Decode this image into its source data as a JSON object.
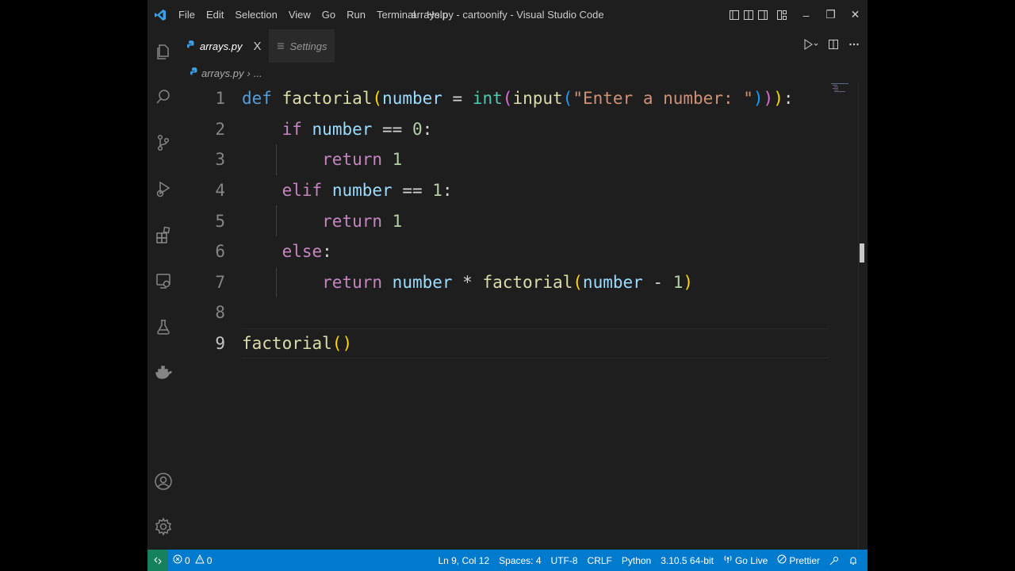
{
  "window": {
    "title": "arrays.py - cartoonify - Visual Studio Code",
    "minimize": "–",
    "maximize": "❐",
    "close": "✕"
  },
  "menu": [
    "File",
    "Edit",
    "Selection",
    "View",
    "Go",
    "Run",
    "Terminal",
    "Help"
  ],
  "activity_bar": [
    "explorer-icon",
    "search-icon",
    "source-control-icon",
    "run-debug-icon",
    "extensions-icon",
    "remote-explorer-icon",
    "testing-icon",
    "docker-icon",
    "accounts-icon",
    "settings-gear-icon"
  ],
  "tabs": [
    {
      "label": "arrays.py",
      "close": "X",
      "icon": "python-icon"
    },
    {
      "label": "Settings",
      "icon": "settings-list-icon"
    }
  ],
  "breadcrumb": {
    "file": "arrays.py",
    "separator": "›",
    "more": "..."
  },
  "editor": {
    "current_line": 9,
    "lines": [
      {
        "num": "1",
        "tokens": [
          [
            "kw",
            "def"
          ],
          [
            "op",
            " "
          ],
          [
            "fn",
            "factorial"
          ],
          [
            "br1",
            "("
          ],
          [
            "var",
            "number"
          ],
          [
            "op",
            " = "
          ],
          [
            "bi",
            "int"
          ],
          [
            "br2",
            "("
          ],
          [
            "fn",
            "input"
          ],
          [
            "br3",
            "("
          ],
          [
            "str",
            "\"Enter a number: \""
          ],
          [
            "br3",
            ")"
          ],
          [
            "br2",
            ")"
          ],
          [
            "br1",
            ")"
          ],
          [
            "op",
            ":"
          ]
        ]
      },
      {
        "num": "2",
        "tokens": [
          [
            "op",
            "    "
          ],
          [
            "ctrl",
            "if"
          ],
          [
            "op",
            " "
          ],
          [
            "var",
            "number"
          ],
          [
            "op",
            " == "
          ],
          [
            "num",
            "0"
          ],
          [
            "op",
            ":"
          ]
        ]
      },
      {
        "num": "3",
        "tokens": [
          [
            "op",
            "        "
          ],
          [
            "ctrl",
            "return"
          ],
          [
            "op",
            " "
          ],
          [
            "num",
            "1"
          ]
        ]
      },
      {
        "num": "4",
        "tokens": [
          [
            "op",
            "    "
          ],
          [
            "ctrl",
            "elif"
          ],
          [
            "op",
            " "
          ],
          [
            "var",
            "number"
          ],
          [
            "op",
            " == "
          ],
          [
            "num",
            "1"
          ],
          [
            "op",
            ":"
          ]
        ]
      },
      {
        "num": "5",
        "tokens": [
          [
            "op",
            "        "
          ],
          [
            "ctrl",
            "return"
          ],
          [
            "op",
            " "
          ],
          [
            "num",
            "1"
          ]
        ]
      },
      {
        "num": "6",
        "tokens": [
          [
            "op",
            "    "
          ],
          [
            "ctrl",
            "else"
          ],
          [
            "op",
            ":"
          ]
        ]
      },
      {
        "num": "7",
        "tokens": [
          [
            "op",
            "        "
          ],
          [
            "ctrl",
            "return"
          ],
          [
            "op",
            " "
          ],
          [
            "var",
            "number"
          ],
          [
            "op",
            " * "
          ],
          [
            "fn",
            "factorial"
          ],
          [
            "br1",
            "("
          ],
          [
            "var",
            "number"
          ],
          [
            "op",
            " - "
          ],
          [
            "num",
            "1"
          ],
          [
            "br1",
            ")"
          ]
        ]
      },
      {
        "num": "8",
        "tokens": []
      },
      {
        "num": "9",
        "tokens": [
          [
            "fn",
            "factorial"
          ],
          [
            "br1",
            "()"
          ]
        ]
      }
    ]
  },
  "status_bar": {
    "errors": "0",
    "warnings": "0",
    "position": "Ln 9, Col 12",
    "spaces": "Spaces: 4",
    "encoding": "UTF-8",
    "eol": "CRLF",
    "language": "Python",
    "interpreter": "3.10.5 64-bit",
    "go_live": "Go Live",
    "prettier": "Prettier"
  },
  "colors": {
    "status_bar": "#007acc",
    "remote": "#16825d",
    "editor_bg": "#1e1e1e",
    "accent": "#0078d4"
  }
}
